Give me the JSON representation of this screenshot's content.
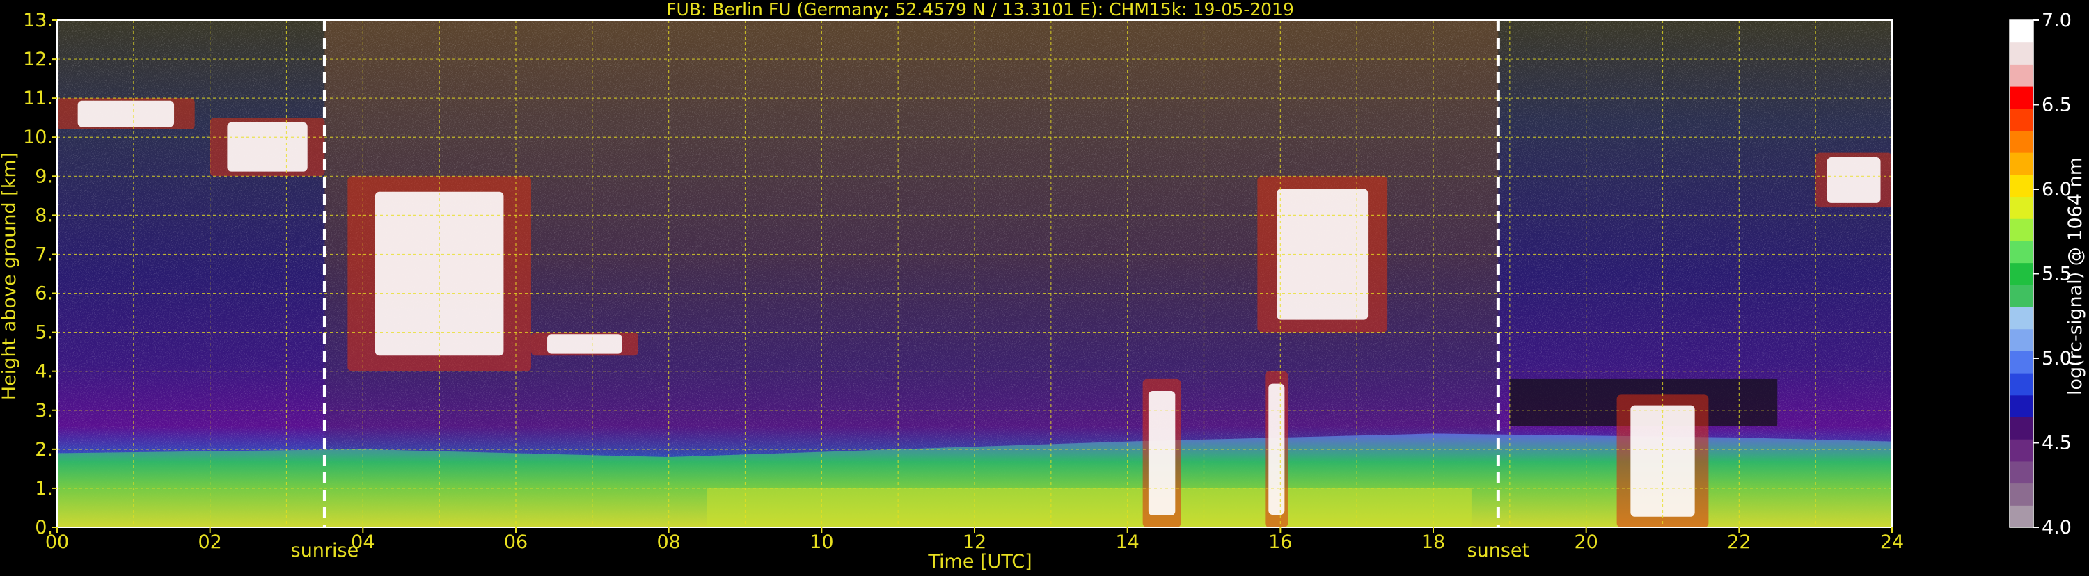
{
  "chart_data": {
    "type": "heatmap",
    "title": "FUB: Berlin FU (Germany; 52.4579 N / 13.3101 E):    CHM15k: 19-05-2019",
    "xlabel": "Time [UTC]",
    "ylabel": "Height above ground [km]",
    "xlim": [
      0,
      24
    ],
    "ylim": [
      0,
      13
    ],
    "x_ticks": [
      "00",
      "02",
      "04",
      "06",
      "08",
      "10",
      "12",
      "14",
      "16",
      "18",
      "20",
      "22",
      "24"
    ],
    "y_ticks": [
      "0.",
      "1.",
      "2.",
      "3.",
      "4.",
      "5.",
      "6.",
      "7.",
      "8.",
      "9.",
      "10.",
      "11.",
      "12.",
      "13."
    ],
    "grid": true,
    "colorbar": {
      "label": "log(rc-signal) @ 1064 nm",
      "range": [
        4.0,
        7.0
      ],
      "ticks": [
        "4.0",
        "4.5",
        "5.0",
        "5.5",
        "6.0",
        "6.5",
        "7.0"
      ],
      "colors": [
        "#a898a8",
        "#8c6c90",
        "#7a4a88",
        "#6a2a80",
        "#4a1070",
        "#1818b8",
        "#2848e0",
        "#5078f0",
        "#80a8f0",
        "#a0c8f0",
        "#40c060",
        "#20c040",
        "#60e060",
        "#a0f040",
        "#e0f020",
        "#ffe000",
        "#ffb000",
        "#ff8000",
        "#ff4000",
        "#ff0000",
        "#f0b0b0",
        "#f0e0e0",
        "#ffffff"
      ]
    },
    "annotations": [
      {
        "label": "sunrise",
        "x": 3.5
      },
      {
        "label": "sunset",
        "x": 18.85
      }
    ],
    "features": {
      "cirrus_clouds": [
        {
          "t_start": 0.0,
          "t_end": 1.8,
          "h_low": 10.2,
          "h_high": 11.0
        },
        {
          "t_start": 2.0,
          "t_end": 3.5,
          "h_low": 9.0,
          "h_high": 10.5
        },
        {
          "t_start": 3.8,
          "t_end": 6.2,
          "h_low": 4.0,
          "h_high": 9.0
        },
        {
          "t_start": 6.2,
          "t_end": 7.6,
          "h_low": 4.4,
          "h_high": 5.0
        },
        {
          "t_start": 15.7,
          "t_end": 17.4,
          "h_low": 5.0,
          "h_high": 9.0
        },
        {
          "t_start": 23.0,
          "t_end": 24.0,
          "h_low": 8.2,
          "h_high": 9.6
        }
      ],
      "boundary_layer_clouds": [
        {
          "t_start": 14.2,
          "t_end": 14.7,
          "h_low": 0.0,
          "h_high": 3.8
        },
        {
          "t_start": 15.8,
          "t_end": 16.1,
          "h_low": 0.0,
          "h_high": 4.0
        },
        {
          "t_start": 20.4,
          "t_end": 21.6,
          "h_low": 0.0,
          "h_high": 3.4
        }
      ],
      "boundary_layer_top_km": [
        {
          "t": 0,
          "h": 1.9
        },
        {
          "t": 4,
          "h": 2.0
        },
        {
          "t": 8,
          "h": 1.8
        },
        {
          "t": 11,
          "h": 2.0
        },
        {
          "t": 14,
          "h": 2.2
        },
        {
          "t": 18,
          "h": 2.4
        },
        {
          "t": 22,
          "h": 2.3
        },
        {
          "t": 24,
          "h": 2.2
        }
      ]
    }
  }
}
